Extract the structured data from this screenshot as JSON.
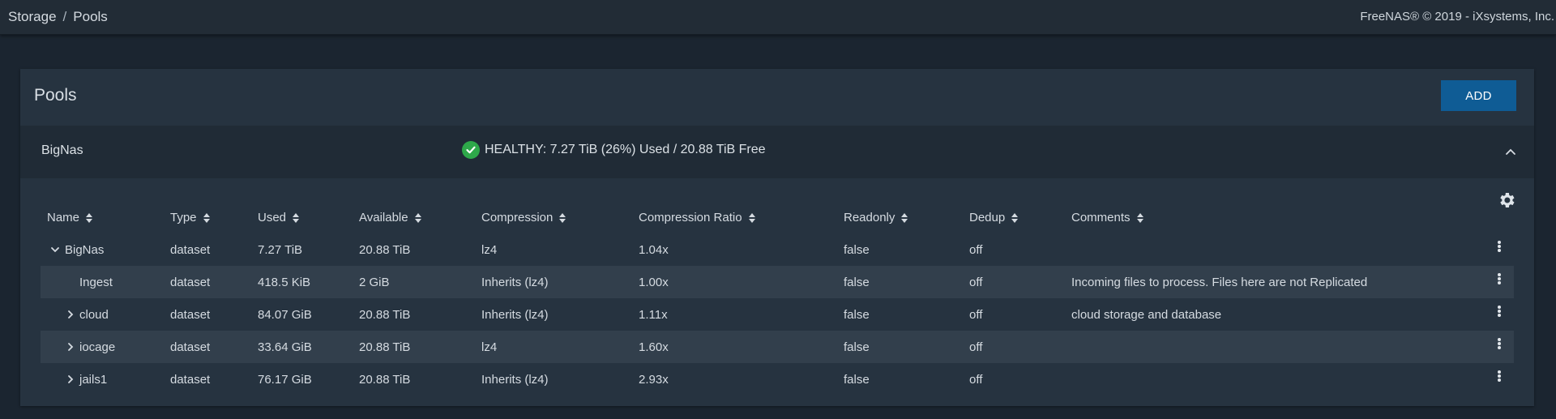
{
  "topbar": {
    "breadcrumb": [
      "Storage",
      "Pools"
    ],
    "separator": "/",
    "copyright": "FreeNAS® © 2019 - iXsystems, Inc."
  },
  "card": {
    "title": "Pools",
    "add_label": "ADD"
  },
  "pool": {
    "name": "BigNas",
    "status": "HEALTHY: 7.27 TiB (26%) Used / 20.88 TiB Free",
    "status_icon": "check-circle-icon",
    "status_color": "#2ea84a"
  },
  "table": {
    "columns": [
      "Name",
      "Type",
      "Used",
      "Available",
      "Compression",
      "Compression Ratio",
      "Readonly",
      "Dedup",
      "Comments"
    ],
    "rows": [
      {
        "name": "BigNas",
        "type": "dataset",
        "used": "7.27 TiB",
        "available": "20.88 TiB",
        "compression": "lz4",
        "ratio": "1.04x",
        "readonly": "false",
        "dedup": "off",
        "comments": ""
      },
      {
        "name": "Ingest",
        "type": "dataset",
        "used": "418.5 KiB",
        "available": "2 GiB",
        "compression": "Inherits (lz4)",
        "ratio": "1.00x",
        "readonly": "false",
        "dedup": "off",
        "comments": "Incoming files to process. Files here are not Replicated"
      },
      {
        "name": "cloud",
        "type": "dataset",
        "used": "84.07 GiB",
        "available": "20.88 TiB",
        "compression": "Inherits (lz4)",
        "ratio": "1.11x",
        "readonly": "false",
        "dedup": "off",
        "comments": "cloud storage and database"
      },
      {
        "name": "iocage",
        "type": "dataset",
        "used": "33.64 GiB",
        "available": "20.88 TiB",
        "compression": "lz4",
        "ratio": "1.60x",
        "readonly": "false",
        "dedup": "off",
        "comments": ""
      },
      {
        "name": "jails1",
        "type": "dataset",
        "used": "76.17 GiB",
        "available": "20.88 TiB",
        "compression": "Inherits (lz4)",
        "ratio": "2.93x",
        "readonly": "false",
        "dedup": "off",
        "comments": ""
      }
    ]
  },
  "colors": {
    "accent": "#0f5c95",
    "background": "#1b2530",
    "card": "#263340"
  }
}
